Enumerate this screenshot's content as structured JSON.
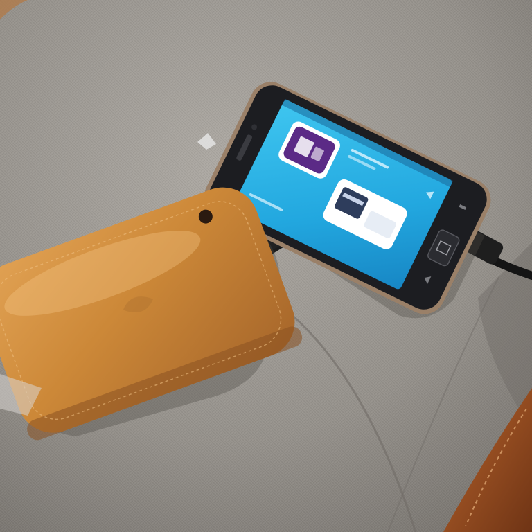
{
  "scene": {
    "subjects": [
      "fabric-seat",
      "smartphone",
      "power-bank",
      "usb-cable",
      "leather-edge"
    ],
    "colors": {
      "fabric": "#9a9690",
      "fabric_shadow": "#7c7873",
      "phone_body": "#1c1d21",
      "phone_frame": "#9a8068",
      "screen": "#2ab0e6",
      "power_bank": "#c98536",
      "leather": "#9a4f22",
      "app_icon": "#5b2a86"
    },
    "icons": [
      "app-tile-icon",
      "card-tile-icon",
      "home-button-icon",
      "back-icon",
      "menu-icon",
      "camera-icon"
    ]
  }
}
